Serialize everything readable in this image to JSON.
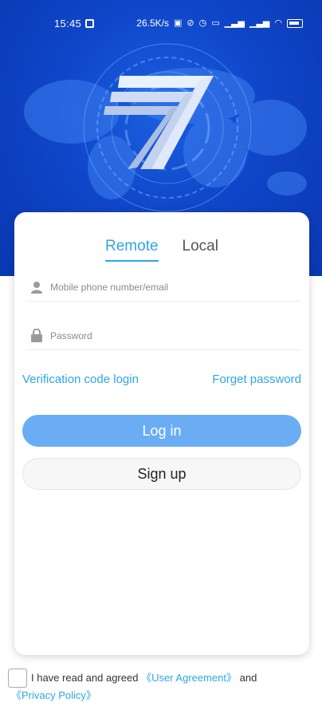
{
  "status_bar": {
    "time": "15:45",
    "network_speed": "26.5K/s"
  },
  "tabs": [
    {
      "label": "Remote",
      "active": true
    },
    {
      "label": "Local",
      "active": false
    }
  ],
  "form": {
    "username_placeholder": "Mobile phone number/email",
    "password_placeholder": "Password"
  },
  "links": {
    "verification_login": "Verification code login",
    "forget_password": "Forget password"
  },
  "buttons": {
    "login": "Log in",
    "signup": "Sign up"
  },
  "agreement": {
    "prefix": "I have read and agreed",
    "user_agreement": "《User Agreement》",
    "and": "and",
    "privacy_policy": "《Privacy Policy》"
  },
  "colors": {
    "accent": "#2ea6e6",
    "login_button": "#6aadf5",
    "hero_blue": "#0f46c9"
  }
}
